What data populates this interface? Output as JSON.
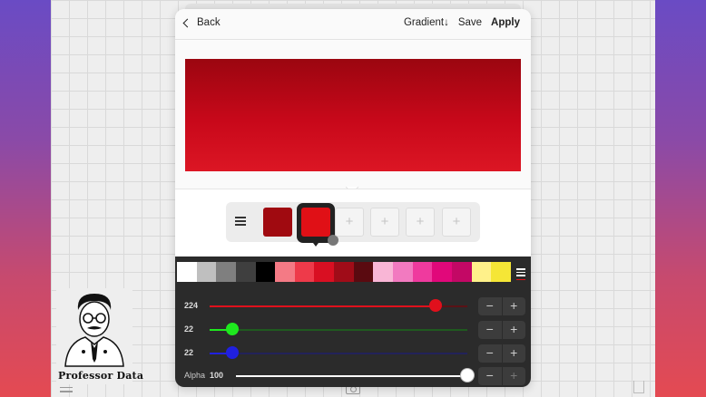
{
  "header": {
    "back_label": "Back",
    "gradient_label": "Gradient↓",
    "save_label": "Save",
    "apply_label": "Apply"
  },
  "preview": {
    "gradient_top": "#9b0610",
    "gradient_bottom": "#dc1624"
  },
  "gradient_stops": [
    {
      "color": "#a00a10",
      "selected": false
    },
    {
      "color": "#e01016",
      "selected": true
    },
    {
      "color": null,
      "label": "+"
    },
    {
      "color": null,
      "label": "+"
    },
    {
      "color": null,
      "label": "+"
    },
    {
      "color": null,
      "label": "+"
    }
  ],
  "palette": [
    "#ffffff",
    "#bfbfbf",
    "#7f7f7f",
    "#3f3f3f",
    "#000000",
    "#f47a85",
    "#ee3a4a",
    "#d90f22",
    "#a00c18",
    "#5a0a10",
    "#f9b6d6",
    "#f27ac0",
    "#ef3a9e",
    "#e1087a",
    "#c30865",
    "#fff18a",
    "#f5e636"
  ],
  "sliders": {
    "red": {
      "label": "224",
      "value": 224,
      "max": 255,
      "color": "#e0101c"
    },
    "green": {
      "label": "22",
      "value": 22,
      "max": 255,
      "color": "#1ee81e"
    },
    "blue": {
      "label": "22",
      "value": 22,
      "max": 255,
      "color": "#2020e0"
    },
    "alpha": {
      "label": "Alpha",
      "value_label": "100",
      "value": 100,
      "max": 100,
      "color": "#ffffff"
    }
  },
  "stepper": {
    "minus": "−",
    "plus": "+"
  },
  "logo": {
    "name": "Professor Data"
  }
}
